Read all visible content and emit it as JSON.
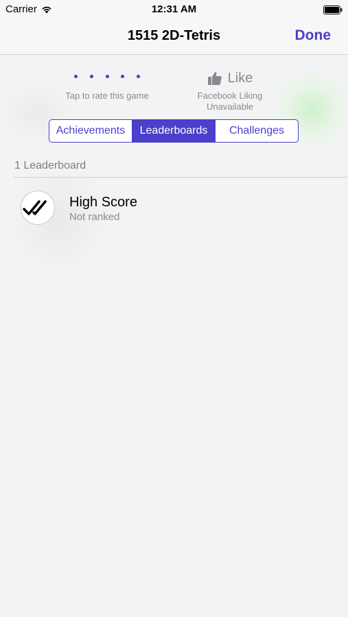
{
  "status_bar": {
    "carrier": "Carrier",
    "time": "12:31 AM"
  },
  "nav": {
    "title": "1515 2D-Tetris",
    "done_label": "Done"
  },
  "rating": {
    "dots": 5,
    "caption": "Tap to rate this game"
  },
  "like": {
    "label": "Like",
    "caption_line1": "Facebook Liking",
    "caption_line2": "Unavailable"
  },
  "tabs": [
    {
      "label": "Achievements",
      "selected": false
    },
    {
      "label": "Leaderboards",
      "selected": true
    },
    {
      "label": "Challenges",
      "selected": false
    }
  ],
  "section": {
    "header": "1 Leaderboard"
  },
  "leaderboards": [
    {
      "title": "High Score",
      "subtitle": "Not ranked",
      "icon": "double-check-icon"
    }
  ],
  "colors": {
    "accent": "#4b3fcb",
    "secondary_text": "#8a8a8e",
    "background": "#f3f3f5"
  }
}
